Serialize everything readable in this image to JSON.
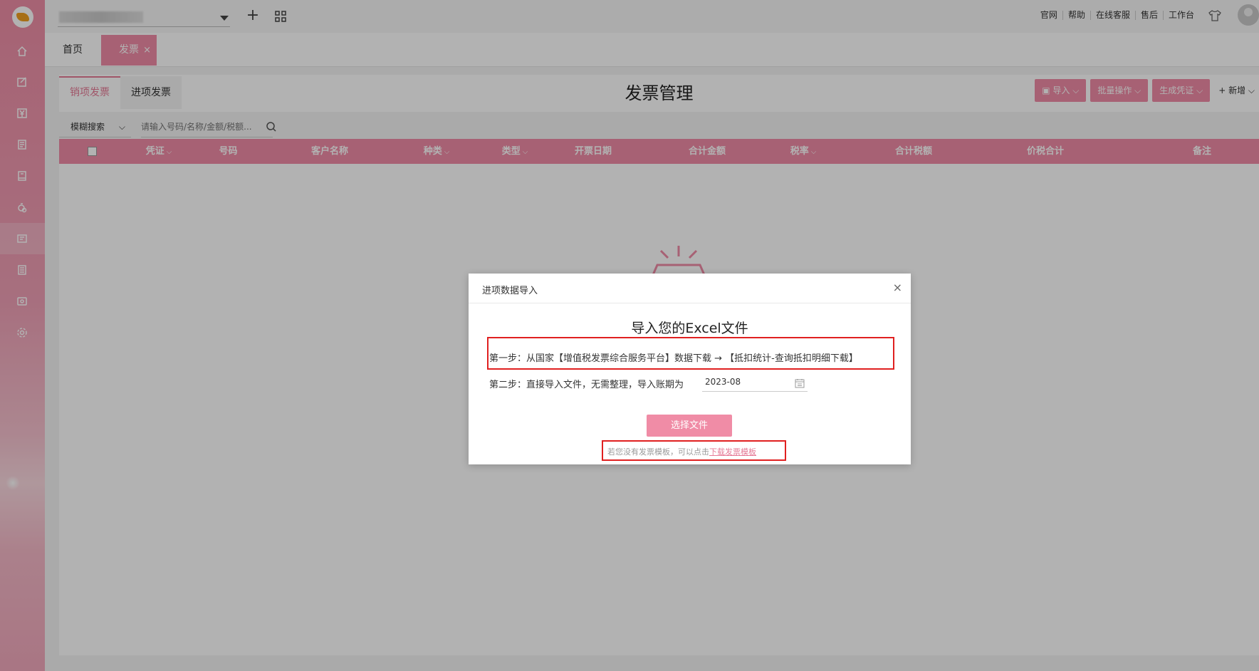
{
  "topbar": {
    "links": [
      "官网",
      "帮助",
      "在线客服",
      "售后",
      "工作台"
    ],
    "icons": {
      "add": "plus-icon",
      "apps": "apps-grid-icon",
      "skin": "shirt-icon",
      "user": "avatar"
    }
  },
  "pagetabs": {
    "home": "首页",
    "invoice": "发票",
    "close": "×"
  },
  "main": {
    "tabs": [
      "销项发票",
      "进项发票"
    ],
    "title": "发票管理",
    "buttons": {
      "import": "导入",
      "batch": "批量操作",
      "voucher": "生成凭证",
      "add": "+ 新增"
    },
    "search": {
      "mode": "模糊搜索",
      "placeholder": "请输入号码/名称/金额/税额..."
    },
    "columns": [
      "凭证",
      "号码",
      "客户名称",
      "种类",
      "类型",
      "开票日期",
      "合计金额",
      "税率",
      "合计税额",
      "价税合计",
      "备注"
    ]
  },
  "dialog": {
    "title": "进项数据导入",
    "close": "×",
    "heading": "导入您的Excel文件",
    "step1": "第一步：从国家【增值税发票综合服务平台】数据下载 → 【抵扣统计-查询抵扣明细下载】",
    "step2": "第二步：直接导入文件，无需整理，导入账期为",
    "period": "2023-08",
    "choose_file": "选择文件",
    "tip_prefix": "若您没有发票模板，可以点击",
    "tip_link": "下载发票模板"
  },
  "colors": {
    "accent": "#f08ca6",
    "highlight_box": "#e02020"
  }
}
